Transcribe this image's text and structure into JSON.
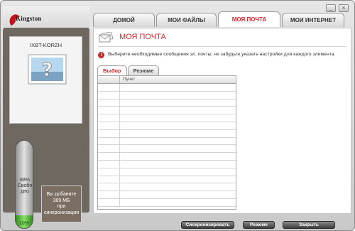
{
  "window": {
    "minimize_glyph": "_",
    "close_glyph": "×"
  },
  "brand": {
    "logo_text": "Kingston",
    "logo_icon": "kingston-head-icon"
  },
  "device": {
    "name": "IXBT-KORZH",
    "image_icon": "unknown-device-question-icon",
    "free_percent_label": "88%",
    "free_label_line1": "Свобо",
    "free_label_line2": "дно",
    "used_percent_label": "10%",
    "used_fraction": 0.1
  },
  "sync_info": {
    "line1": "Вы добавите",
    "line2": "389 МБ",
    "line3": "при",
    "line4": "синхронизации"
  },
  "tabs": [
    {
      "label": "ДОМОЙ",
      "active": false
    },
    {
      "label": "МОИ ФАЙЛЫ",
      "active": false
    },
    {
      "label": "МОЯ ПОЧТА",
      "active": true
    },
    {
      "label": "МОИ ИНТЕРНЕТ",
      "active": false
    }
  ],
  "main": {
    "title": "МОЯ ПОЧТА",
    "title_icon": "mail-envelopes-icon",
    "hint_icon": "alert-icon",
    "hint": "Выберите необходимые сообщения эл. почты; не забудьте указать настройки для каждого элемента.",
    "subtabs": [
      {
        "label": "Выбор",
        "active": true
      },
      {
        "label": "Резюме",
        "active": false
      }
    ],
    "table": {
      "columns": [
        "",
        "Пункт"
      ],
      "rows": []
    }
  },
  "buttons": {
    "sync": "Синхронизировать",
    "summary": "Резюме",
    "close": "Закрыть"
  },
  "colors": {
    "accent": "#d8282e",
    "left_panel": "#6f6860",
    "gauge_fill": "#4fb13a"
  }
}
